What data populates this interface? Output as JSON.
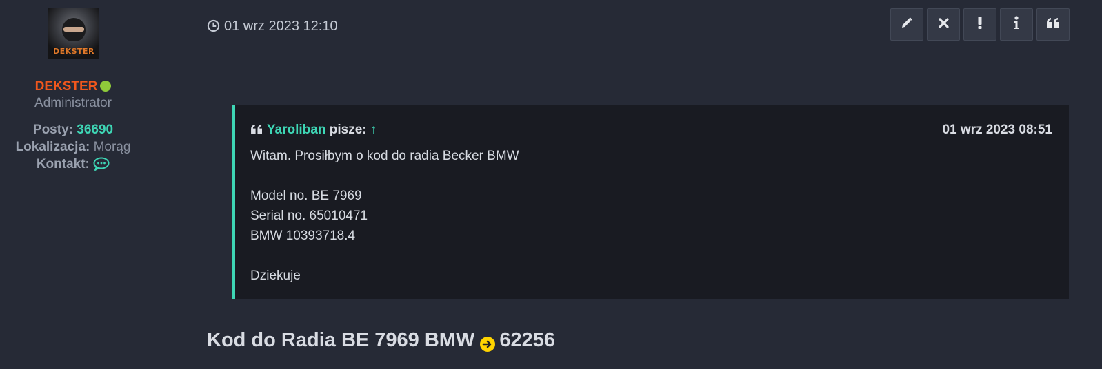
{
  "post": {
    "time": "01 wrz 2023 12:10",
    "actions": [
      {
        "name": "edit",
        "icon": "pencil-icon"
      },
      {
        "name": "delete",
        "icon": "close-icon"
      },
      {
        "name": "report",
        "icon": "exclamation-icon"
      },
      {
        "name": "info",
        "icon": "info-icon"
      },
      {
        "name": "quote",
        "icon": "quote-icon"
      }
    ]
  },
  "author": {
    "avatar_text": "DEKSTER",
    "name": "DEKSTER",
    "status_color": "#8fcb3a",
    "rank": "Administrator",
    "posts_label": "Posty:",
    "posts_value": "36690",
    "location_label": "Lokalizacja:",
    "location_value": "Morąg",
    "contact_label": "Kontakt:"
  },
  "quote": {
    "author": "Yaroliban",
    "says": "pisze:",
    "arrow": "↑",
    "date": "01 wrz 2023 08:51",
    "lines": [
      "Witam. Prosiłbym o kod do radia Becker BMW",
      "",
      "Model no. BE 7969",
      "Serial no. 65010471",
      "BMW 10393718.4",
      "",
      "Dziekuje"
    ]
  },
  "reply": {
    "title": "Kod do Radia BE 7969 BMW",
    "code": "62256"
  },
  "colors": {
    "accent": "#3ed6b5",
    "username": "#f0571d",
    "background": "#262a36"
  }
}
